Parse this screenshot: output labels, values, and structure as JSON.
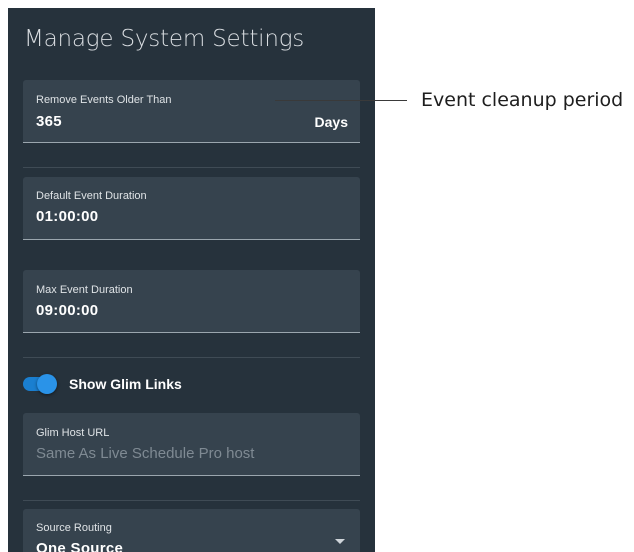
{
  "panel": {
    "title": "Manage System Settings"
  },
  "fields": {
    "remove_events": {
      "label": "Remove Events Older Than",
      "value": "365",
      "suffix": "Days"
    },
    "default_duration": {
      "label": "Default Event Duration",
      "value": "01:00:00"
    },
    "max_duration": {
      "label": "Max Event Duration",
      "value": "09:00:00"
    },
    "glim_host": {
      "label": "Glim Host URL",
      "placeholder": "Same As Live Schedule Pro host"
    },
    "source_routing": {
      "label": "Source Routing",
      "value": "One Source"
    }
  },
  "toggle": {
    "label": "Show Glim Links",
    "checked": true
  },
  "annotation": {
    "callout": "Event cleanup period"
  },
  "colors": {
    "panel_bg": "#26323c",
    "field_bg": "#36434e",
    "accent": "#2a93e8"
  }
}
